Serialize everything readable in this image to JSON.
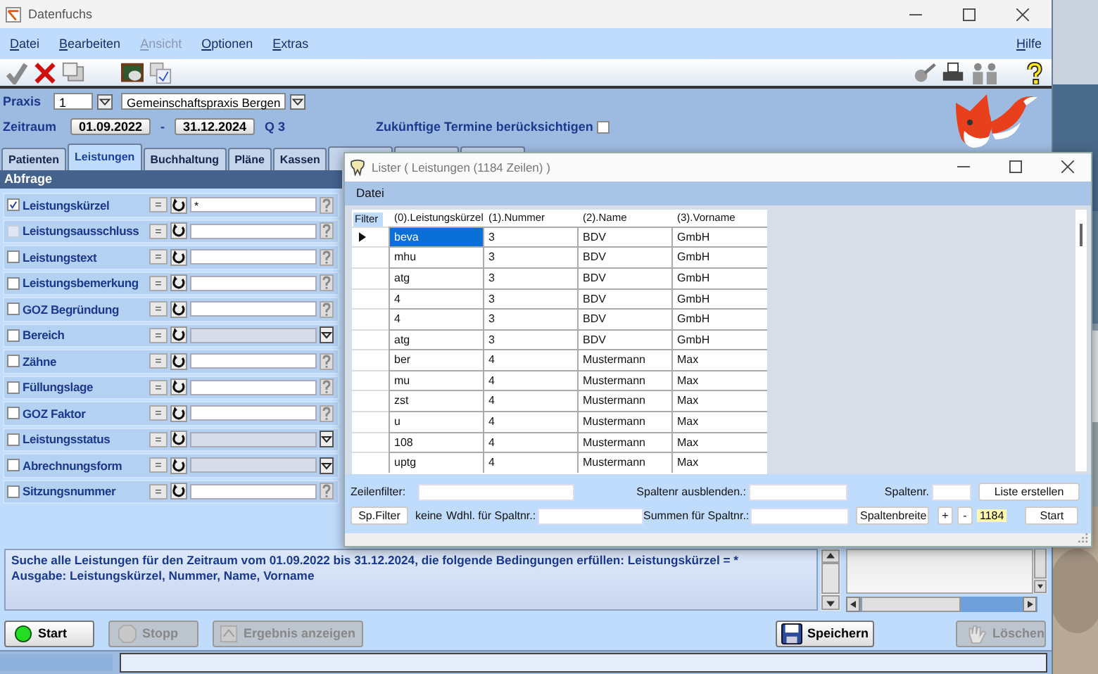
{
  "window": {
    "title": "Datenfuchs"
  },
  "menu": [
    {
      "label": "Datei",
      "disabled": false
    },
    {
      "label": "Bearbeiten",
      "disabled": false
    },
    {
      "label": "Ansicht",
      "disabled": true
    },
    {
      "label": "Optionen",
      "disabled": false
    },
    {
      "label": "Extras",
      "disabled": false
    }
  ],
  "help_menu": {
    "label": "Hilfe"
  },
  "praxis": {
    "label": "Praxis",
    "number": "1",
    "name": "Gemeinschaftspraxis Bergen"
  },
  "zeitraum": {
    "label": "Zeitraum",
    "from": "01.09.2022",
    "separator": "-",
    "to": "31.12.2024",
    "quarter": "Q 3",
    "future_label": "Zukünftige Termine berücksichtigen",
    "future_checked": false
  },
  "tabs": [
    {
      "label": "Patienten",
      "selected": false
    },
    {
      "label": "Leistungen",
      "selected": true
    },
    {
      "label": "Buchhaltung",
      "selected": false
    },
    {
      "label": "Pläne",
      "selected": false
    },
    {
      "label": "Kassen",
      "selected": false
    },
    {
      "selected": false
    },
    {
      "selected": false
    },
    {
      "selected": false
    }
  ],
  "query": {
    "title": "Abfrage",
    "rows": [
      {
        "label": "Leistungskürzel",
        "checked": true,
        "disabled": false,
        "kind": "text",
        "operator": "=",
        "value": "*"
      },
      {
        "label": "Leistungsausschluss",
        "checked": false,
        "disabled": true,
        "kind": "text",
        "operator": "="
      },
      {
        "label": "Leistungstext",
        "checked": false,
        "disabled": false,
        "kind": "text",
        "operator": "="
      },
      {
        "label": "Leistungsbemerkung",
        "checked": false,
        "disabled": false,
        "kind": "text",
        "operator": "="
      },
      {
        "label": "GOZ Begründung",
        "checked": false,
        "disabled": false,
        "kind": "text",
        "operator": "="
      },
      {
        "label": "Bereich",
        "checked": false,
        "disabled": false,
        "kind": "select",
        "operator": "="
      },
      {
        "label": "Zähne",
        "checked": false,
        "disabled": false,
        "kind": "text",
        "operator": "="
      },
      {
        "label": "Füllungslage",
        "checked": false,
        "disabled": false,
        "kind": "text",
        "operator": "="
      },
      {
        "label": "GOZ Faktor",
        "checked": false,
        "disabled": false,
        "kind": "text",
        "operator": "="
      },
      {
        "label": "Leistungsstatus",
        "checked": false,
        "disabled": false,
        "kind": "select",
        "operator": "="
      },
      {
        "label": "Abrechnungsform",
        "checked": false,
        "disabled": false,
        "kind": "select",
        "operator": "="
      },
      {
        "label": "Sitzungsnummer",
        "checked": false,
        "disabled": false,
        "kind": "text",
        "operator": "="
      }
    ]
  },
  "description": [
    "Suche alle Leistungen für den Zeitraum vom 01.09.2022 bis 31.12.2024,  die folgende Bedingungen erfüllen:  Leistungskürzel = *",
    "Ausgabe: Leistungskürzel, Nummer, Name, Vorname"
  ],
  "buttons": [
    {
      "label": "Start",
      "disabled": false,
      "kind": "start"
    },
    {
      "label": "Stopp",
      "disabled": true,
      "kind": "stop"
    },
    {
      "label": "Ergebnis anzeigen",
      "disabled": true,
      "kind": "result"
    },
    {
      "label": "Speichern",
      "disabled": false,
      "kind": "save"
    },
    {
      "label": "Löschen",
      "disabled": true,
      "kind": "delete"
    }
  ],
  "lister": {
    "title": "Lister (  Leistungen  (1184 Zeilen) )",
    "menu": [
      "Datei"
    ],
    "filter_label": "Filter",
    "columns": [
      "(0).Leistungskürzel",
      "(1).Nummer",
      "(2).Name",
      "(3).Vorname"
    ],
    "rows": [
      {
        "cells": [
          "beva",
          "3",
          "BDV",
          "GmbH"
        ],
        "selected": true
      },
      {
        "cells": [
          "mhu",
          "3",
          "BDV",
          "GmbH"
        ],
        "selected": false
      },
      {
        "cells": [
          "atg",
          "3",
          "BDV",
          "GmbH"
        ],
        "selected": false
      },
      {
        "cells": [
          "4",
          "3",
          "BDV",
          "GmbH"
        ],
        "selected": false
      },
      {
        "cells": [
          "4",
          "3",
          "BDV",
          "GmbH"
        ],
        "selected": false
      },
      {
        "cells": [
          "atg",
          "3",
          "BDV",
          "GmbH"
        ],
        "selected": false
      },
      {
        "cells": [
          "ber",
          "4",
          "Mustermann",
          "Max"
        ],
        "selected": false
      },
      {
        "cells": [
          "mu",
          "4",
          "Mustermann",
          "Max"
        ],
        "selected": false
      },
      {
        "cells": [
          "zst",
          "4",
          "Mustermann",
          "Max"
        ],
        "selected": false
      },
      {
        "cells": [
          "u",
          "4",
          "Mustermann",
          "Max"
        ],
        "selected": false
      },
      {
        "cells": [
          "108",
          "4",
          "Mustermann",
          "Max"
        ],
        "selected": false
      },
      {
        "cells": [
          "uptg",
          "4",
          "Mustermann",
          "Max"
        ],
        "selected": false
      }
    ],
    "controls": {
      "row_filter_label": "Zeilenfilter:",
      "hide_columns_label": "Spaltenr ausblenden.:",
      "column_no_label": "Spaltenr.",
      "create_button": "Liste erstellen",
      "col_filter_button": "Sp.Filter",
      "none_label": "keine",
      "repeat_label": "Wdhl. für Spaltnr.:",
      "sums_label": "Summen für Spaltnr.:",
      "width_button": "Spaltenbreite",
      "plus_button": "+",
      "minus_button": "-",
      "count": "1184",
      "start_button": "Start"
    }
  }
}
